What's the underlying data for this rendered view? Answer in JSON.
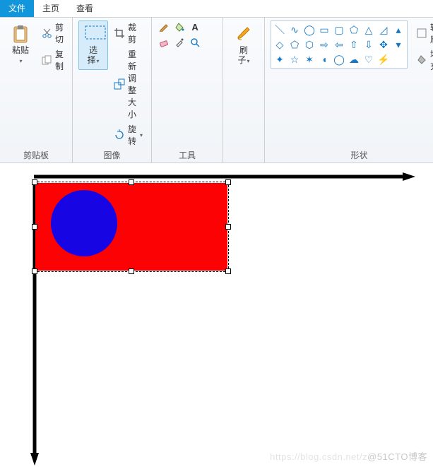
{
  "tabs": {
    "file": "文件",
    "home": "主页",
    "view": "查看"
  },
  "clipboard": {
    "paste": "粘贴",
    "cut": "剪切",
    "copy": "复制",
    "group": "剪贴板"
  },
  "image": {
    "select": "选\n择",
    "crop": "裁剪",
    "resize": "重新调整大小",
    "rotate": "旋转",
    "group": "图像"
  },
  "tools": {
    "group": "工具"
  },
  "brush": {
    "label": "刷\n子"
  },
  "shapes": {
    "group": "形状",
    "outline": "轮廓",
    "fill": "填充"
  },
  "canvas": {
    "rect_color": "#fc0204",
    "circle_color": "#1705e3"
  },
  "watermark": "@51CTO博客",
  "watermark_faint": "https://blog.csdn.net/z"
}
